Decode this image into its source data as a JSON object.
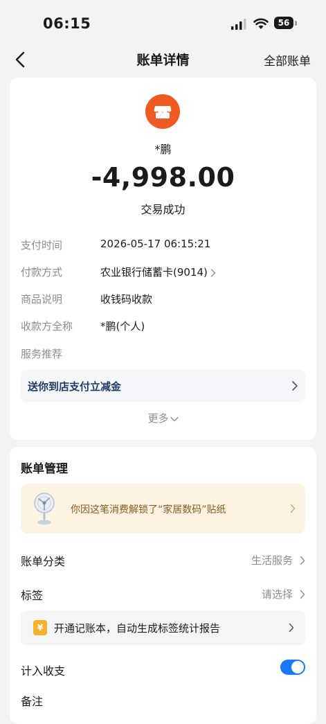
{
  "status_bar": {
    "time": "06:15",
    "battery": "56"
  },
  "nav": {
    "title": "账单详情",
    "right_action": "全部账单"
  },
  "transaction": {
    "payee": "*鹏",
    "amount": "-4,998.00",
    "status": "交易成功",
    "merchant_icon": "shop-icon",
    "accent_color": "#f05a22"
  },
  "details": [
    {
      "label": "支付时间",
      "value": "2026-05-17 06:15:21"
    },
    {
      "label": "付款方式",
      "value": "农业银行储蓄卡(9014)"
    },
    {
      "label": "商品说明",
      "value": "收钱码收款"
    },
    {
      "label": "收款方全称",
      "value": "*鹏(个人)"
    },
    {
      "label": "服务推荐",
      "value": ""
    }
  ],
  "promo": {
    "text": "送你到店支付立减金"
  },
  "more": {
    "label": "更多"
  },
  "management": {
    "title": "账单管理",
    "sticker_text": "你因这笔消费解锁了“家居数码”贴纸",
    "category_label": "账单分类",
    "category_value": "生活服务",
    "tag_label": "标签",
    "tag_placeholder": "请选择",
    "ledger_icon_text": "¥",
    "ledger_text": "开通记账本，自动生成标签统计报告",
    "include_label": "计入收支",
    "include_enabled": true,
    "note_label": "备注",
    "toggle_color": "#1677ff"
  }
}
